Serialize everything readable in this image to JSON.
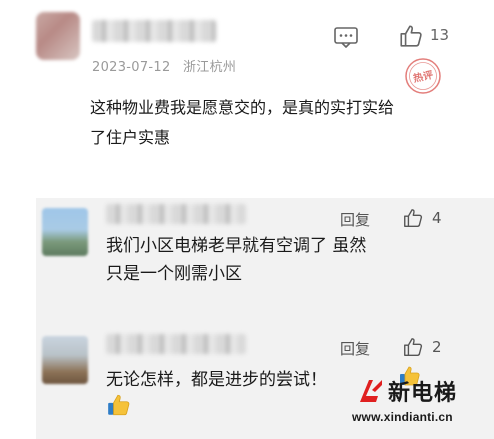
{
  "main_comment": {
    "date": "2023-07-12",
    "location": "浙江杭州",
    "like_count": "13",
    "stamp_text": "热评",
    "text_line1": "这种物业费我是愿意交的，是真的实打实给",
    "text_line2": "了住户实惠"
  },
  "replies": [
    {
      "reply_label": "回复",
      "like_count": "4",
      "text_line1": "我们小区电梯老早就有空调了 虽然",
      "text_line2": "只是一个刚需小区"
    },
    {
      "reply_label": "回复",
      "like_count": "2",
      "text_line1": "无论怎样，都是进步的尝试！"
    }
  ],
  "watermark": {
    "title": "新电梯",
    "url": "www.xindianti.cn"
  },
  "icons": {
    "comment": "comment-bubble-icon",
    "like": "thumbs-up-outline-icon",
    "emoji": "thumbs-up-emoji-icon",
    "logo": "elevator-logo-icon"
  },
  "colors": {
    "reply_background": "#f2f2f2",
    "stamp": "#d9534f",
    "logo_red": "#e02020",
    "emoji_yellow": "#f5c23a"
  }
}
